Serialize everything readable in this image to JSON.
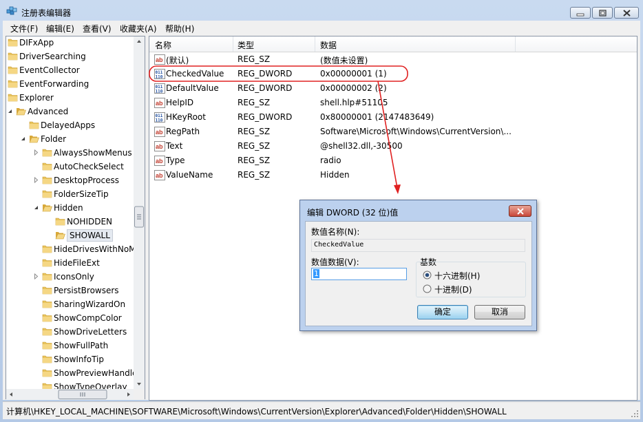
{
  "window": {
    "title": "注册表编辑器",
    "accent": "#b9cde8"
  },
  "menu": [
    "文件(F)",
    "编辑(E)",
    "查看(V)",
    "收藏夹(A)",
    "帮助(H)"
  ],
  "tree": [
    {
      "label": "DIFxApp",
      "level": 0,
      "expander": "none",
      "open": false
    },
    {
      "label": "DriverSearching",
      "level": 0,
      "expander": "none",
      "open": false
    },
    {
      "label": "EventCollector",
      "level": 0,
      "expander": "none",
      "open": false
    },
    {
      "label": "EventForwarding",
      "level": 0,
      "expander": "none",
      "open": false
    },
    {
      "label": "Explorer",
      "level": 0,
      "expander": "none",
      "open": false
    },
    {
      "label": "Advanced",
      "level": 1,
      "expander": "open",
      "open": true
    },
    {
      "label": "DelayedApps",
      "level": 2,
      "expander": "none",
      "open": false
    },
    {
      "label": "Folder",
      "level": 2,
      "expander": "open",
      "open": true
    },
    {
      "label": "AlwaysShowMenus",
      "level": 3,
      "expander": "closed",
      "open": false
    },
    {
      "label": "AutoCheckSelect",
      "level": 3,
      "expander": "none",
      "open": false
    },
    {
      "label": "DesktopProcess",
      "level": 3,
      "expander": "closed",
      "open": false
    },
    {
      "label": "FolderSizeTip",
      "level": 3,
      "expander": "none",
      "open": false
    },
    {
      "label": "Hidden",
      "level": 3,
      "expander": "open",
      "open": true
    },
    {
      "label": "NOHIDDEN",
      "level": 4,
      "expander": "none",
      "open": false
    },
    {
      "label": "SHOWALL",
      "level": 4,
      "expander": "none",
      "open": true,
      "selected": true
    },
    {
      "label": "HideDrivesWithNoMedia",
      "level": 3,
      "expander": "none",
      "open": false
    },
    {
      "label": "HideFileExt",
      "level": 3,
      "expander": "none",
      "open": false
    },
    {
      "label": "IconsOnly",
      "level": 3,
      "expander": "closed",
      "open": false
    },
    {
      "label": "PersistBrowsers",
      "level": 3,
      "expander": "none",
      "open": false
    },
    {
      "label": "SharingWizardOn",
      "level": 3,
      "expander": "none",
      "open": false
    },
    {
      "label": "ShowCompColor",
      "level": 3,
      "expander": "none",
      "open": false
    },
    {
      "label": "ShowDriveLetters",
      "level": 3,
      "expander": "none",
      "open": false
    },
    {
      "label": "ShowFullPath",
      "level": 3,
      "expander": "none",
      "open": false
    },
    {
      "label": "ShowInfoTip",
      "level": 3,
      "expander": "none",
      "open": false
    },
    {
      "label": "ShowPreviewHandlers",
      "level": 3,
      "expander": "none",
      "open": false
    },
    {
      "label": "ShowTypeOverlay",
      "level": 3,
      "expander": "none",
      "open": false
    }
  ],
  "columns": [
    "名称",
    "类型",
    "数据"
  ],
  "values": [
    {
      "icon": "string-value-icon",
      "name": "(默认)",
      "type": "REG_SZ",
      "data": "(数值未设置)"
    },
    {
      "icon": "dword-value-icon",
      "name": "CheckedValue",
      "type": "REG_DWORD",
      "data": "0x00000001 (1)"
    },
    {
      "icon": "dword-value-icon",
      "name": "DefaultValue",
      "type": "REG_DWORD",
      "data": "0x00000002 (2)"
    },
    {
      "icon": "string-value-icon",
      "name": "HelpID",
      "type": "REG_SZ",
      "data": "shell.hlp#51105"
    },
    {
      "icon": "dword-value-icon",
      "name": "HKeyRoot",
      "type": "REG_DWORD",
      "data": "0x80000001 (2147483649)"
    },
    {
      "icon": "string-value-icon",
      "name": "RegPath",
      "type": "REG_SZ",
      "data": "Software\\Microsoft\\Windows\\CurrentVersion\\..."
    },
    {
      "icon": "string-value-icon",
      "name": "Text",
      "type": "REG_SZ",
      "data": "@shell32.dll,-30500"
    },
    {
      "icon": "string-value-icon",
      "name": "Type",
      "type": "REG_SZ",
      "data": "radio"
    },
    {
      "icon": "string-value-icon",
      "name": "ValueName",
      "type": "REG_SZ",
      "data": "Hidden"
    }
  ],
  "status": {
    "path": "计算机\\HKEY_LOCAL_MACHINE\\SOFTWARE\\Microsoft\\Windows\\CurrentVersion\\Explorer\\Advanced\\Folder\\Hidden\\SHOWALL"
  },
  "dialog": {
    "title": "编辑 DWORD (32 位)值",
    "name_label": "数值名称(N):",
    "name_value": "CheckedValue",
    "data_label": "数值数据(V):",
    "data_value": "1",
    "base_label": "基数",
    "radio_hex": "十六进制(H)",
    "radio_dec": "十进制(D)",
    "selected_base": "hex",
    "ok": "确定",
    "cancel": "取消"
  },
  "annotation_color": "#e02020"
}
